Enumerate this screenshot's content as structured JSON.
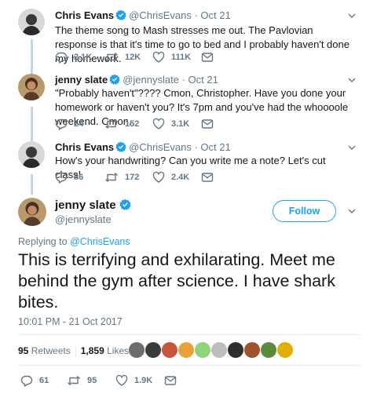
{
  "colors": {
    "accent": "#1da1f2",
    "text": "#14171a",
    "muted": "#657786",
    "thread": "#c5d6e2"
  },
  "tweets": [
    {
      "name": "Chris Evans",
      "handle": "@ChrisEvans",
      "dot": "·",
      "date": "Oct 21",
      "text": "The theme song to Mash stresses me out. The Pavlovian response is that it's time to go to bed and I probably haven't done my homework.",
      "replies": "2.1K",
      "retweets": "12K",
      "likes": "111K"
    },
    {
      "name": "jenny slate",
      "handle": "@jennyslate",
      "dot": "·",
      "date": "Oct 21",
      "text": "\"Probably haven't\"???? Cmon, Christopher. Have you done your homework or haven't you? It's 7pm and you've had the whoooole weekend. Cmon.",
      "replies": "24",
      "retweets": "152",
      "likes": "3.1K"
    },
    {
      "name": "Chris Evans",
      "handle": "@ChrisEvans",
      "dot": "·",
      "date": "Oct 21",
      "text": "How's your handwriting? Can you write me a note? Let's cut class!",
      "replies": "86",
      "retweets": "172",
      "likes": "2.4K"
    }
  ],
  "focus": {
    "name": "jenny slate",
    "handle": "@jennyslate",
    "follow_label": "Follow",
    "replying_prefix": "Replying to",
    "replying_to": "@ChrisEvans",
    "text": "This is terrifying and exhilarating. Meet me behind the gym after science. I have shark bites.",
    "timestamp": "10:01 PM - 21 Oct 2017",
    "retweets_count": "95",
    "retweets_label": "Retweets",
    "likes_count": "1,859",
    "likes_label": "Likes",
    "replies": "61",
    "retweets": "95",
    "likes": "1.9K"
  },
  "icons": [
    "verified-badge-icon",
    "reply-icon",
    "retweet-icon",
    "like-icon",
    "message-icon",
    "chevron-down-icon"
  ]
}
